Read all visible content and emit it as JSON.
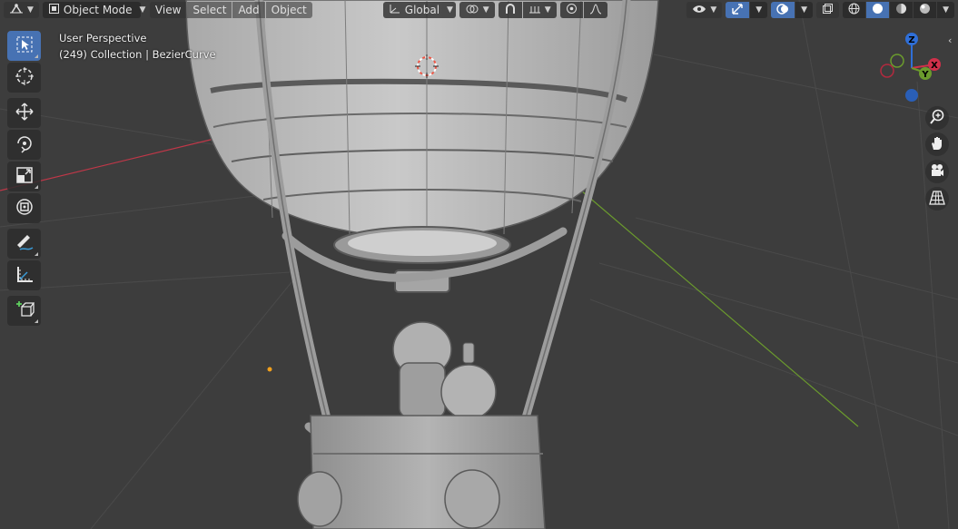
{
  "header": {
    "mode": "Object Mode",
    "menus": [
      "View",
      "Select",
      "Add",
      "Object"
    ],
    "orientation": "Global"
  },
  "viewport": {
    "view_name": "User Perspective",
    "collection_info": "(249) Collection | BezierCurve"
  },
  "gizmo": {
    "z": "Z",
    "x": "X",
    "y": "Y"
  },
  "colors": {
    "accent": "#4772b3",
    "x_axis": "#d0304a",
    "y_axis": "#6b9b2d",
    "z_axis": "#2f6fd8"
  },
  "icons": {
    "toolbar": [
      "select-box-icon",
      "cursor-icon",
      "move-icon",
      "rotate-icon",
      "scale-icon",
      "transform-icon",
      "annotate-icon",
      "measure-icon",
      "add-cube-icon"
    ],
    "nav": [
      "zoom-icon",
      "hand-pan-icon",
      "camera-icon",
      "grid-ortho-icon"
    ]
  }
}
